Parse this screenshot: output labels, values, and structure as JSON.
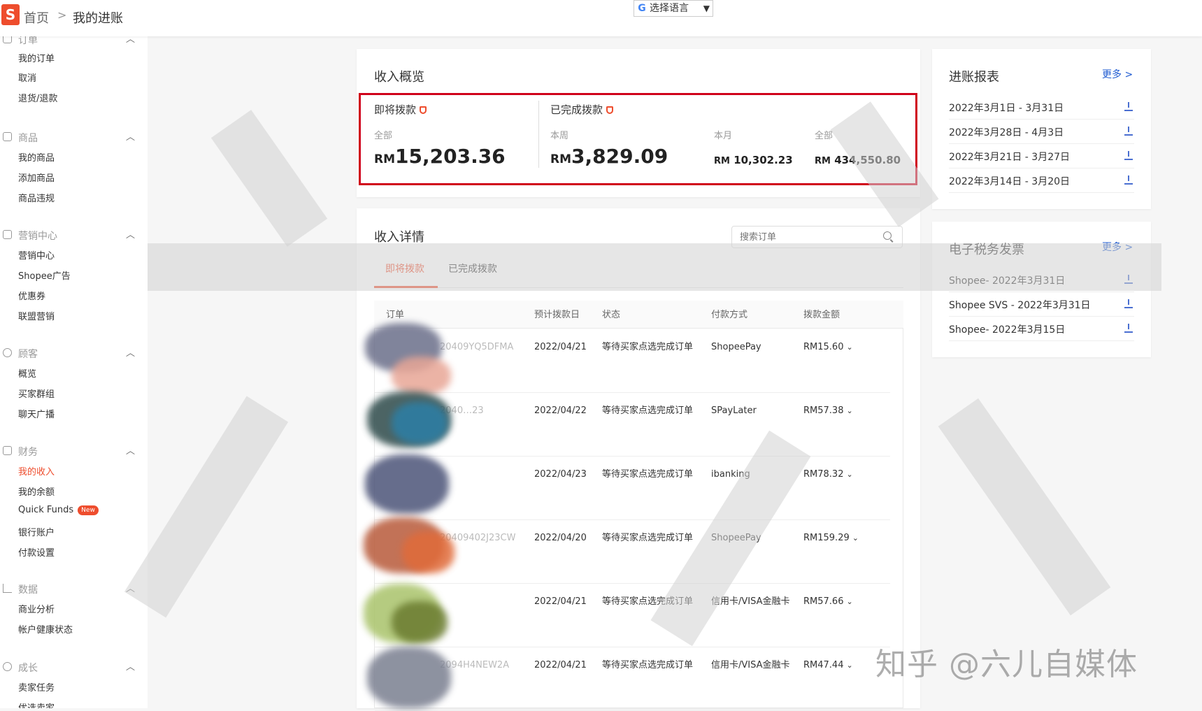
{
  "breadcrumb": {
    "home": "首页",
    "separator": ">",
    "current": "我的进账"
  },
  "language": {
    "label": "选择语言",
    "google": "G",
    "arrow": "▼"
  },
  "sidebar": [
    {
      "title": "订单",
      "icon": "order-icon",
      "items": [
        {
          "label": "我的订单"
        },
        {
          "label": "取消"
        },
        {
          "label": "退货/退款"
        }
      ]
    },
    {
      "title": "商品",
      "icon": "product-icon",
      "items": [
        {
          "label": "我的商品"
        },
        {
          "label": "添加商品"
        },
        {
          "label": "商品违规"
        }
      ]
    },
    {
      "title": "营销中心",
      "icon": "tag-icon",
      "items": [
        {
          "label": "营销中心"
        },
        {
          "label": "Shopee广告"
        },
        {
          "label": "优惠券"
        },
        {
          "label": "联盟营销"
        }
      ]
    },
    {
      "title": "顾客",
      "icon": "user-icon",
      "items": [
        {
          "label": "概览"
        },
        {
          "label": "买家群组"
        },
        {
          "label": "聊天广播"
        }
      ]
    },
    {
      "title": "财务",
      "icon": "wallet-icon",
      "items": [
        {
          "label": "我的收入",
          "active": true
        },
        {
          "label": "我的余额"
        },
        {
          "label": "Quick Funds",
          "badge": "New"
        },
        {
          "label": "银行账户"
        },
        {
          "label": "付款设置"
        }
      ]
    },
    {
      "title": "数据",
      "icon": "chart-icon",
      "items": [
        {
          "label": "商业分析"
        },
        {
          "label": "帐户健康状态"
        }
      ]
    },
    {
      "title": "成长",
      "icon": "growth-icon",
      "items": [
        {
          "label": "卖家任务"
        },
        {
          "label": "优选卖家"
        }
      ]
    }
  ],
  "overview": {
    "title": "收入概览",
    "upcoming": {
      "label": "即将拨款",
      "sub": "全部",
      "currency": "RM",
      "amount": "15,203.36"
    },
    "completed": {
      "label": "已完成拨款",
      "week": {
        "sub": "本周",
        "currency": "RM",
        "amount": "3,829.09"
      },
      "month": {
        "sub": "本月",
        "currency": "RM",
        "amount": "10,302.23"
      },
      "total": {
        "sub": "全部",
        "currency": "RM",
        "amount": "434,550.80"
      }
    }
  },
  "details": {
    "title": "收入详情",
    "search_placeholder": "搜索订单",
    "tabs": [
      "即将拨款",
      "已完成拨款"
    ],
    "columns": [
      "订单",
      "预计拨款日",
      "状态",
      "付款方式",
      "拨款金额"
    ],
    "rows": [
      {
        "order": "20409YQ5DFMA",
        "date": "2022/04/21",
        "status": "等待买家点选完成订单",
        "method": "ShopeePay",
        "amount": "RM15.60"
      },
      {
        "order": "2040…23",
        "date": "2022/04/22",
        "status": "等待买家点选完成订单",
        "method": "SPayLater",
        "amount": "RM57.38"
      },
      {
        "order": "",
        "date": "2022/04/23",
        "status": "等待买家点选完成订单",
        "method": "ibanking",
        "amount": "RM78.32"
      },
      {
        "order": "20409402J23CW",
        "date": "2022/04/20",
        "status": "等待买家点选完成订单",
        "method": "ShopeePay",
        "amount": "RM159.29"
      },
      {
        "order": "",
        "date": "2022/04/21",
        "status": "等待买家点选完成订单",
        "method": "信用卡/VISA金融卡",
        "amount": "RM57.66"
      },
      {
        "order": "2094H4NEW2A",
        "date": "2022/04/21",
        "status": "等待买家点选完成订单",
        "method": "信用卡/VISA金融卡",
        "amount": "RM47.44"
      }
    ],
    "caret": "⌄"
  },
  "reports": {
    "title": "进账报表",
    "more": "更多 >",
    "items": [
      "2022年3月1日 - 3月31日",
      "2022年3月28日 - 4月3日",
      "2022年3月21日 - 3月27日",
      "2022年3月14日 - 3月20日"
    ]
  },
  "invoices": {
    "title": "电子税务发票",
    "more": "更多 >",
    "items": [
      "Shopee- 2022年3月31日",
      "Shopee SVS - 2022年3月31日",
      "Shopee- 2022年3月15日"
    ]
  },
  "watermark": "知乎 @六儿自媒体",
  "colors": {
    "brand": "#ee4d2d",
    "highlight_box": "#d0021b",
    "link": "#1f5bd1"
  }
}
